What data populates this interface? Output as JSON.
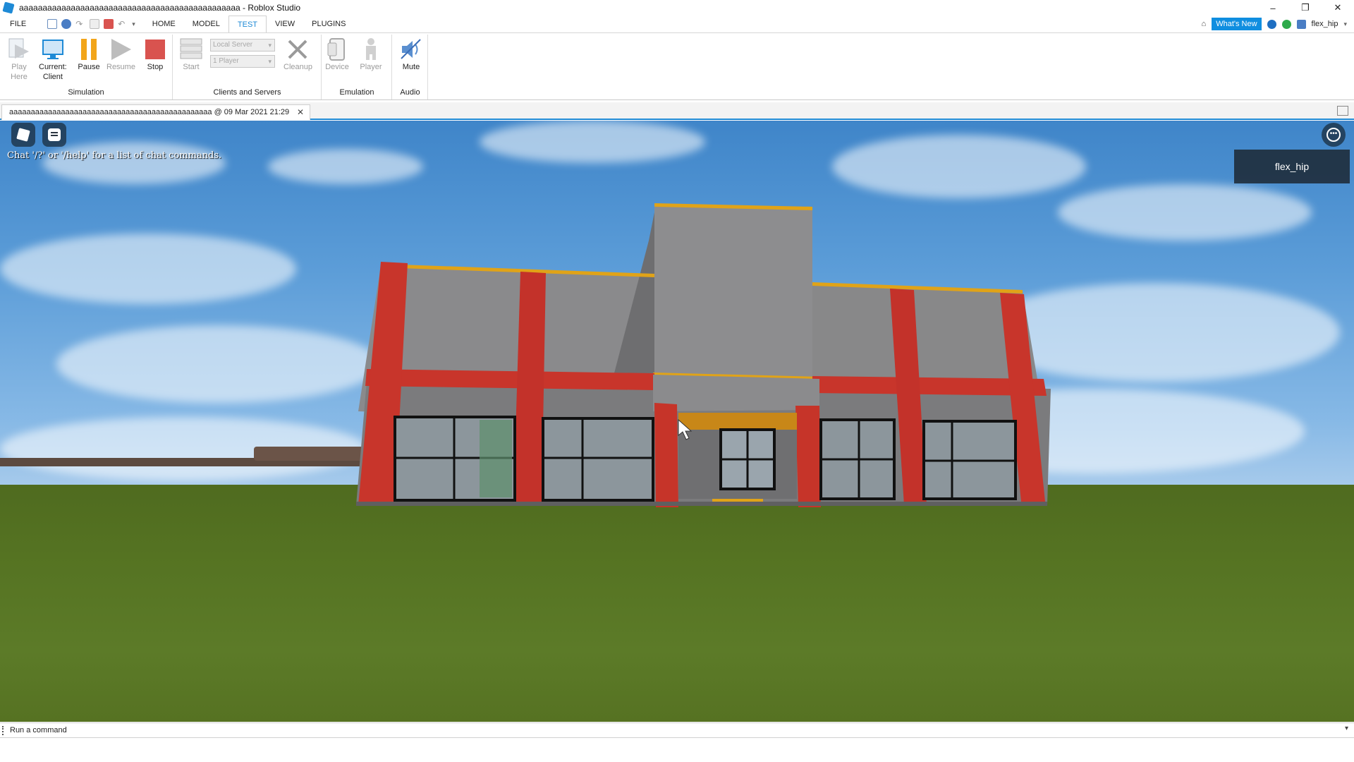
{
  "window": {
    "title": "aaaaaaaaaaaaaaaaaaaaaaaaaaaaaaaaaaaaaaaaaaaaaaa - Roblox Studio",
    "controls": {
      "minimize": "–",
      "restore": "❐",
      "close": "✕"
    }
  },
  "menubar": {
    "file": "FILE",
    "tabs": [
      "HOME",
      "MODEL",
      "TEST",
      "VIEW",
      "PLUGINS"
    ],
    "active_tab": "TEST",
    "whats_new": "What's New",
    "username": "flex_hip"
  },
  "ribbon": {
    "simulation": {
      "label": "Simulation",
      "play_here": [
        "Play",
        "Here"
      ],
      "current_client": [
        "Current:",
        "Client"
      ],
      "pause": "Pause",
      "resume": "Resume",
      "stop": "Stop"
    },
    "clients_servers": {
      "label": "Clients and Servers",
      "start": "Start",
      "server_select": "Local Server",
      "players_select": "1 Player",
      "cleanup": "Cleanup"
    },
    "emulation": {
      "label": "Emulation",
      "device": "Device",
      "player": "Player"
    },
    "audio": {
      "label": "Audio",
      "mute": "Mute"
    }
  },
  "document_tab": {
    "name": "aaaaaaaaaaaaaaaaaaaaaaaaaaaaaaaaaaaaaaaaaaaaaaa @ 09 Mar 2021 21:29",
    "close": "✕"
  },
  "viewport": {
    "chat_hint": "Chat '/?' or '/help' for a list of chat commands.",
    "player_list": [
      "flex_hip"
    ]
  },
  "command_bar": {
    "placeholder": "Run a command"
  },
  "colors": {
    "accent": "#1e8ad6",
    "pause": "#f2a51a",
    "stop": "#d9534f",
    "brick": "#c8352b",
    "concrete": "#8c8c8e",
    "trim": "#e0a318"
  }
}
